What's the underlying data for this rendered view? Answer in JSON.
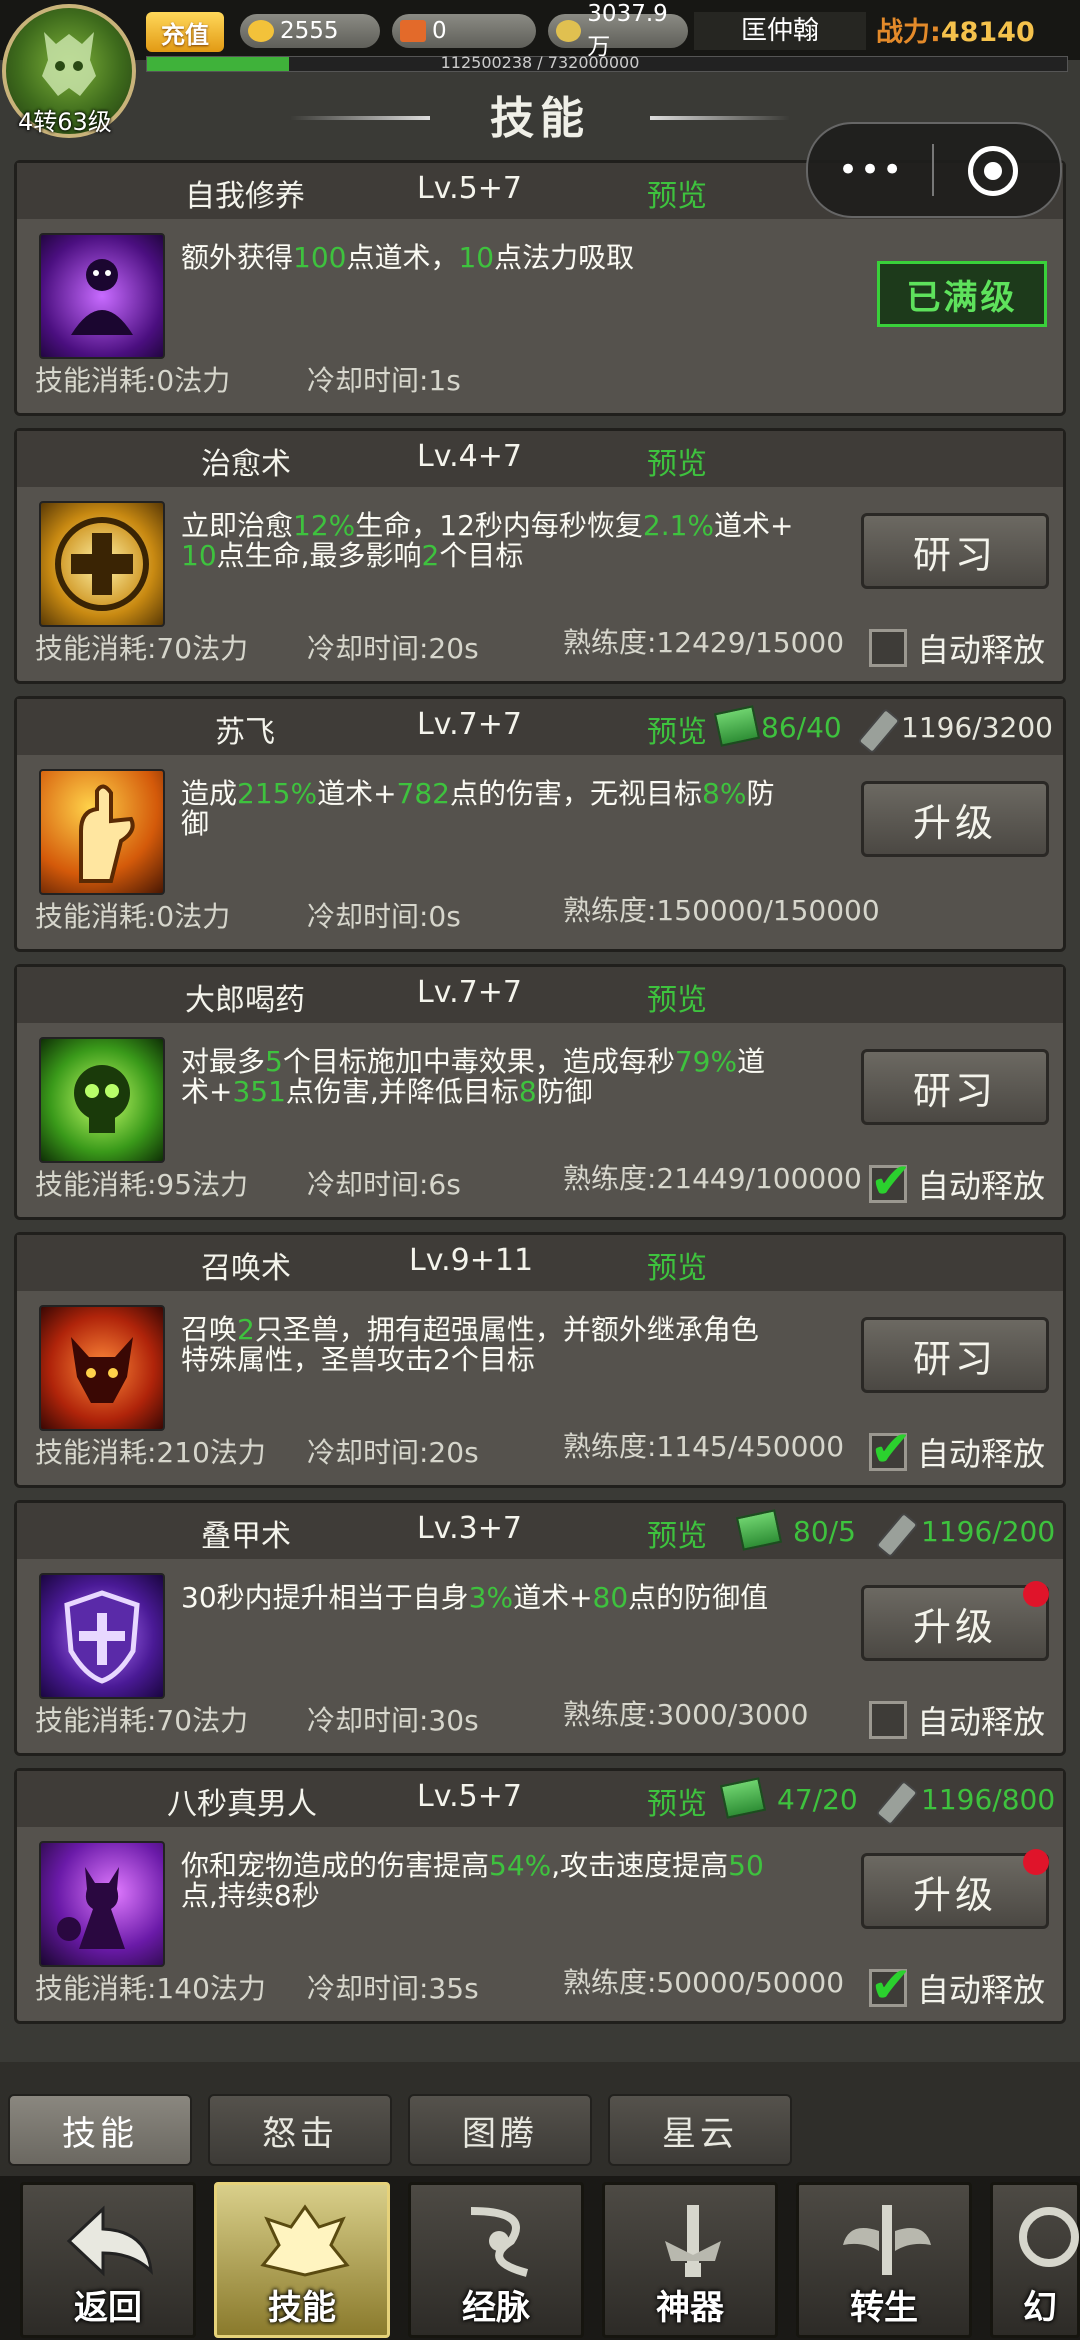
{
  "header": {
    "level_label": "4转63级",
    "recharge_label": "充值",
    "gold": "2555",
    "tickets": "0",
    "coins": "3037.9万",
    "player_name": "匡仲翰",
    "power_label": "战力:",
    "power_value": "48140",
    "exp_text": "112500238 / 732000000",
    "exp_fraction": 0.154
  },
  "page": {
    "title": "技能"
  },
  "skills": [
    {
      "name": "自我修养",
      "level": "Lv.5+7",
      "preview": "预览",
      "desc": [
        [
          "额外获得",
          ""
        ],
        [
          "100",
          "g"
        ],
        [
          "点道术，",
          ""
        ],
        [
          "10",
          "g"
        ],
        [
          "点法力吸取",
          ""
        ]
      ],
      "cost": "技能消耗:0法力",
      "cooldown": "冷却时间:1s",
      "status": "已满级",
      "icon": "purple-meditation-icon"
    },
    {
      "name": "治愈术",
      "level": "Lv.4+7",
      "preview": "预览",
      "desc_text": "立即治愈12%生命，12秒内每秒恢复2.1%道术+10点生命,最多影响2个目标",
      "cost": "技能消耗:70法力",
      "cooldown": "冷却时间:20s",
      "proficiency": "熟练度:12429/15000",
      "button": "研习",
      "auto_label": "自动释放",
      "auto_on": false,
      "icon": "golden-cross-icon"
    },
    {
      "name": "苏飞",
      "level": "Lv.7+7",
      "preview": "预览",
      "books": "86/40",
      "scrolls": "1196/3200",
      "desc_text": "造成215%道术+782点的伤害，无视目标8%防御",
      "cost": "技能消耗:0法力",
      "cooldown": "冷却时间:0s",
      "proficiency": "熟练度:150000/150000",
      "button": "升级",
      "icon": "flame-hand-icon"
    },
    {
      "name": "大郎喝药",
      "level": "Lv.7+7",
      "preview": "预览",
      "desc_text": "对最多5个目标施加中毒效果，造成每秒79%道术+351点伤害,并降低目标8防御",
      "cost": "技能消耗:95法力",
      "cooldown": "冷却时间:6s",
      "proficiency": "熟练度:21449/100000",
      "button": "研习",
      "auto_label": "自动释放",
      "auto_on": true,
      "icon": "green-skull-icon"
    },
    {
      "name": "召唤术",
      "level": "Lv.9+11",
      "preview": "预览",
      "desc_text": "召唤2只圣兽，拥有超强属性，并额外继承角色特殊属性，圣兽攻击2个目标",
      "cost": "技能消耗:210法力",
      "cooldown": "冷却时间:20s",
      "proficiency": "熟练度:1145/450000",
      "button": "研习",
      "auto_label": "自动释放",
      "auto_on": true,
      "icon": "red-beast-icon"
    },
    {
      "name": "叠甲术",
      "level": "Lv.3+7",
      "preview": "预览",
      "books": "80/5",
      "scrolls": "1196/200",
      "desc_text": "30秒内提升相当于自身3%道术+80点的防御值",
      "cost": "技能消耗:70法力",
      "cooldown": "冷却时间:30s",
      "proficiency": "熟练度:3000/3000",
      "button": "升级",
      "auto_label": "自动释放",
      "auto_on": false,
      "icon": "purple-shield-icon"
    },
    {
      "name": "八秒真男人",
      "level": "Lv.5+7",
      "preview": "预览",
      "books": "47/20",
      "scrolls": "1196/800",
      "desc_text": "你和宠物造成的伤害提高54%,攻击速度提高50点,持续8秒",
      "cost": "技能消耗:140法力",
      "cooldown": "冷却时间:35s",
      "proficiency": "熟练度:50000/50000",
      "button": "升级",
      "auto_label": "自动释放",
      "auto_on": true,
      "icon": "purple-demon-icon"
    }
  ],
  "subtabs": [
    "技能",
    "怒击",
    "图腾",
    "星云"
  ],
  "nav": [
    "返回",
    "技能",
    "经脉",
    "神器",
    "转生",
    "幻"
  ],
  "colors": {
    "highlight": "#3ec23e",
    "background": "#3a3a36",
    "card": "#55524d"
  }
}
